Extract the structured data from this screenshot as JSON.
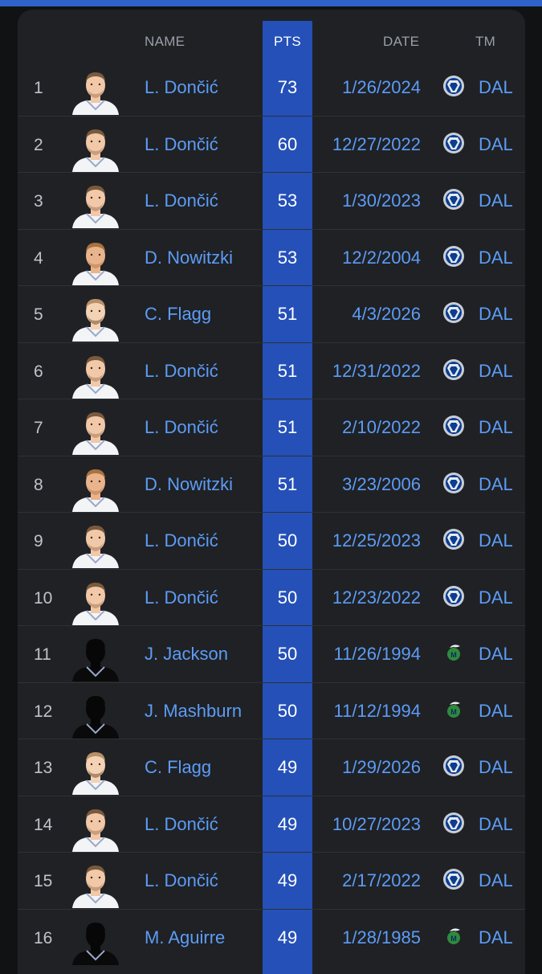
{
  "header": {
    "name": "NAME",
    "pts": "PTS",
    "date": "DATE",
    "tm": "TM"
  },
  "colors": {
    "accent_link": "#5d9cf5",
    "pts_column": "#2450b8",
    "background": "#1f2125"
  },
  "rows": [
    {
      "rank": "1",
      "name": "L. Dončić",
      "pts": "73",
      "date": "1/26/2024",
      "team": "DAL",
      "avatar": "luka",
      "logo": "mavs-modern-logo"
    },
    {
      "rank": "2",
      "name": "L. Dončić",
      "pts": "60",
      "date": "12/27/2022",
      "team": "DAL",
      "avatar": "luka",
      "logo": "mavs-modern-logo"
    },
    {
      "rank": "3",
      "name": "L. Dončić",
      "pts": "53",
      "date": "1/30/2023",
      "team": "DAL",
      "avatar": "luka",
      "logo": "mavs-modern-logo"
    },
    {
      "rank": "4",
      "name": "D. Nowitzki",
      "pts": "53",
      "date": "12/2/2004",
      "team": "DAL",
      "avatar": "dirk",
      "logo": "mavs-modern-logo"
    },
    {
      "rank": "5",
      "name": "C. Flagg",
      "pts": "51",
      "date": "4/3/2026",
      "team": "DAL",
      "avatar": "flagg",
      "logo": "mavs-modern-logo"
    },
    {
      "rank": "6",
      "name": "L. Dončić",
      "pts": "51",
      "date": "12/31/2022",
      "team": "DAL",
      "avatar": "luka",
      "logo": "mavs-modern-logo"
    },
    {
      "rank": "7",
      "name": "L. Dončić",
      "pts": "51",
      "date": "2/10/2022",
      "team": "DAL",
      "avatar": "luka",
      "logo": "mavs-modern-logo"
    },
    {
      "rank": "8",
      "name": "D. Nowitzki",
      "pts": "51",
      "date": "3/23/2006",
      "team": "DAL",
      "avatar": "dirk",
      "logo": "mavs-modern-logo"
    },
    {
      "rank": "9",
      "name": "L. Dončić",
      "pts": "50",
      "date": "12/25/2023",
      "team": "DAL",
      "avatar": "luka",
      "logo": "mavs-modern-logo"
    },
    {
      "rank": "10",
      "name": "L. Dončić",
      "pts": "50",
      "date": "12/23/2022",
      "team": "DAL",
      "avatar": "luka",
      "logo": "mavs-modern-logo"
    },
    {
      "rank": "11",
      "name": "J. Jackson",
      "pts": "50",
      "date": "11/26/1994",
      "team": "DAL",
      "avatar": "silhouette",
      "logo": "mavs-retro-logo"
    },
    {
      "rank": "12",
      "name": "J. Mashburn",
      "pts": "50",
      "date": "11/12/1994",
      "team": "DAL",
      "avatar": "silhouette",
      "logo": "mavs-retro-logo"
    },
    {
      "rank": "13",
      "name": "C. Flagg",
      "pts": "49",
      "date": "1/29/2026",
      "team": "DAL",
      "avatar": "flagg",
      "logo": "mavs-modern-logo"
    },
    {
      "rank": "14",
      "name": "L. Dončić",
      "pts": "49",
      "date": "10/27/2023",
      "team": "DAL",
      "avatar": "luka",
      "logo": "mavs-modern-logo"
    },
    {
      "rank": "15",
      "name": "L. Dončić",
      "pts": "49",
      "date": "2/17/2022",
      "team": "DAL",
      "avatar": "luka",
      "logo": "mavs-modern-logo"
    },
    {
      "rank": "16",
      "name": "M. Aguirre",
      "pts": "49",
      "date": "1/28/1985",
      "team": "DAL",
      "avatar": "silhouette",
      "logo": "mavs-retro-logo"
    }
  ]
}
